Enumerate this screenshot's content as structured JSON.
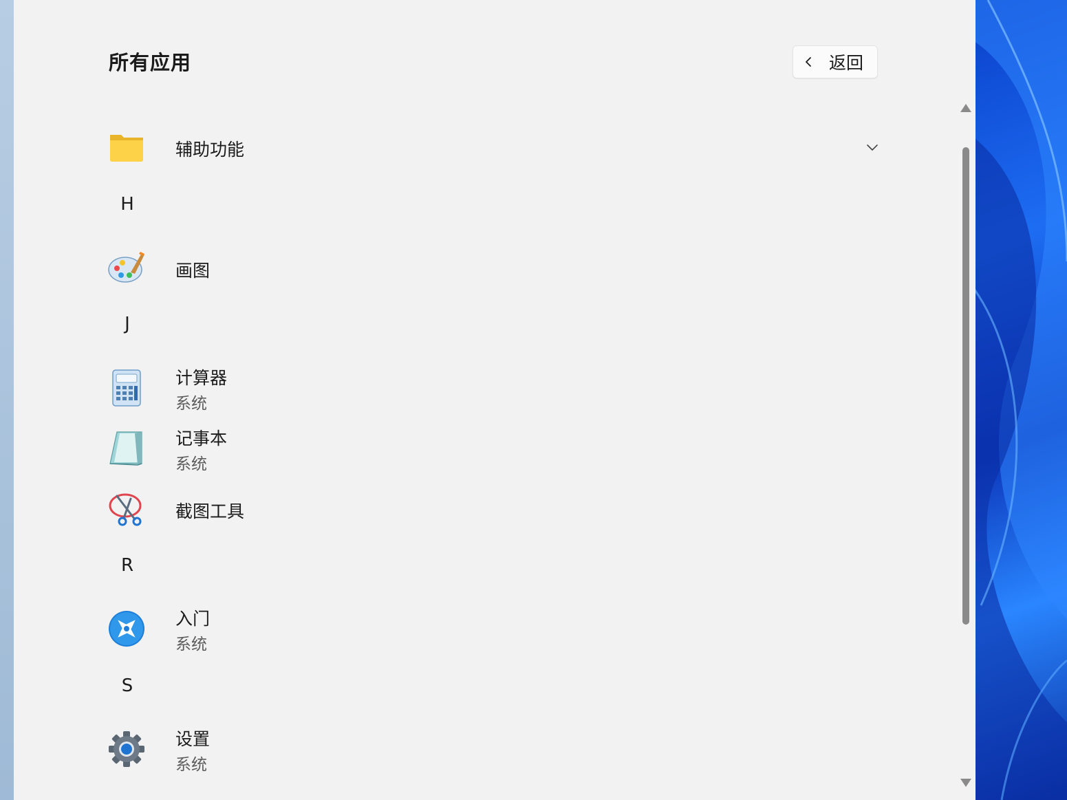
{
  "header": {
    "title": "所有应用",
    "back_label": "返回"
  },
  "sections": [
    {
      "type": "app",
      "icon": "folder-icon",
      "name": "辅助功能",
      "expandable": true
    },
    {
      "type": "letter",
      "label": "H"
    },
    {
      "type": "app",
      "icon": "paint-icon",
      "name": "画图"
    },
    {
      "type": "letter",
      "label": "J"
    },
    {
      "type": "app",
      "icon": "calculator-icon",
      "name": "计算器",
      "subtitle": "系统"
    },
    {
      "type": "app",
      "icon": "notepad-icon",
      "name": "记事本",
      "subtitle": "系统"
    },
    {
      "type": "app",
      "icon": "snipping-tool-icon",
      "name": "截图工具"
    },
    {
      "type": "letter",
      "label": "R"
    },
    {
      "type": "app",
      "icon": "get-started-icon",
      "name": "入门",
      "subtitle": "系统"
    },
    {
      "type": "letter",
      "label": "S"
    },
    {
      "type": "app",
      "icon": "settings-gear-icon",
      "name": "设置",
      "subtitle": "系统"
    }
  ],
  "colors": {
    "panel_bg": "#f2f2f2",
    "text_primary": "#1b1b1b",
    "text_secondary": "#5c5c5c",
    "wallpaper_blue": "#1d6df2"
  }
}
